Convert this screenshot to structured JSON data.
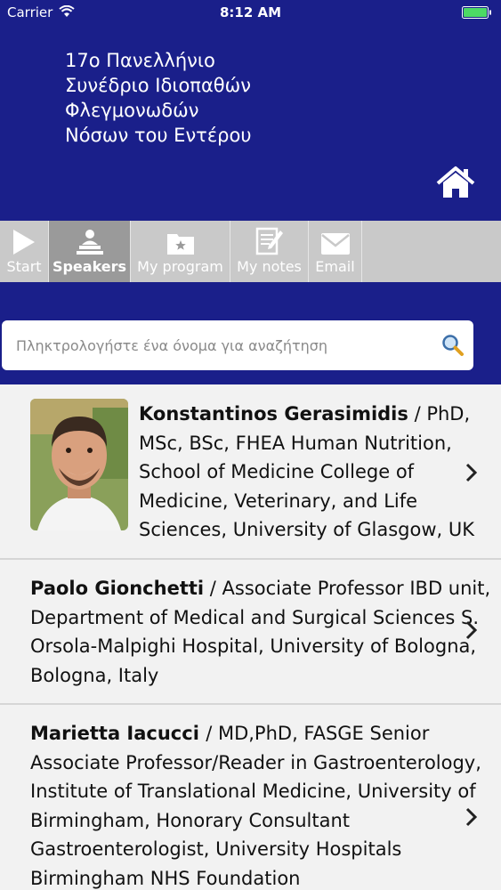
{
  "status": {
    "carrier": "Carrier",
    "time": "8:12 AM"
  },
  "header": {
    "title": "17ο Πανελλήνιο\nΣυνέδριο Ιδιοπαθών\nΦλεγμονωδών\nΝόσων του Εντέρου"
  },
  "tabs": [
    {
      "label": "Start",
      "icon": "play-icon"
    },
    {
      "label": "Speakers",
      "icon": "speaker-icon",
      "active": true
    },
    {
      "label": "My program",
      "icon": "folder-star-icon"
    },
    {
      "label": "My notes",
      "icon": "notes-icon"
    },
    {
      "label": "Email",
      "icon": "envelope-icon"
    }
  ],
  "search": {
    "placeholder": "Πληκτρολογήστε ένα όνομα για αναζήτηση"
  },
  "speakers": [
    {
      "name": "Konstantinos Gerasimidis",
      "details": " / PhD, MSc, BSc, FHEA Human Nutrition, School of Medicine College of Medicine, Veterinary, and Life Sciences, University of Glasgow, UK"
    },
    {
      "name": "Paolo Gionchetti",
      "details": " / Associate Professor IBD unit, Department of Medical and Surgical Sciences S. Orsola-Malpighi Hospital, University of Bologna, Bologna, Italy"
    },
    {
      "name": "Marietta Iacucci ",
      "details": " / MD,PhD, FASGE Senior Associate Professor/Reader in Gastroenterology, Institute of Translational Medicine, University of Birmingham, Honorary Consultant Gastroenterologist, University Hospitals Birmingham NHS Foundation"
    }
  ],
  "colors": {
    "header_bg": "#1a1f8a",
    "tab_bg": "#c9c9c9",
    "tab_active": "#9a9a9a"
  }
}
